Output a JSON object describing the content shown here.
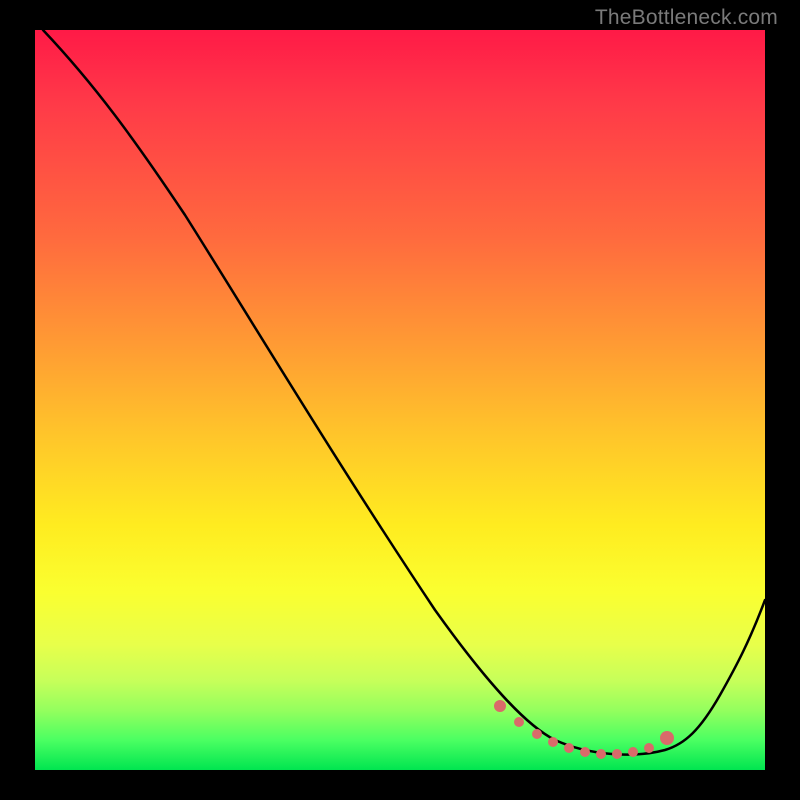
{
  "watermark": "TheBottleneck.com",
  "chart_data": {
    "type": "line",
    "title": "",
    "xlabel": "",
    "ylabel": "",
    "xlim": [
      0,
      100
    ],
    "ylim": [
      0,
      100
    ],
    "series": [
      {
        "name": "bottleneck-curve",
        "x": [
          0,
          6,
          12,
          18,
          24,
          30,
          36,
          42,
          48,
          54,
          60,
          64,
          68,
          72,
          76,
          80,
          83,
          86,
          90,
          94,
          98,
          100
        ],
        "y": [
          100,
          96,
          90,
          83,
          76,
          68,
          60,
          52,
          44,
          36,
          28,
          21,
          14,
          8,
          4,
          2,
          1,
          1,
          3,
          10,
          20,
          27
        ]
      },
      {
        "name": "highlight-dots",
        "x": [
          64,
          68,
          71,
          73,
          75,
          77,
          79,
          81,
          83,
          85,
          87
        ],
        "y": [
          12,
          9,
          7,
          6,
          5,
          5,
          5,
          5,
          5,
          6,
          9
        ]
      }
    ],
    "colors": {
      "curve": "#000000",
      "dots": "#d96a6a"
    }
  }
}
